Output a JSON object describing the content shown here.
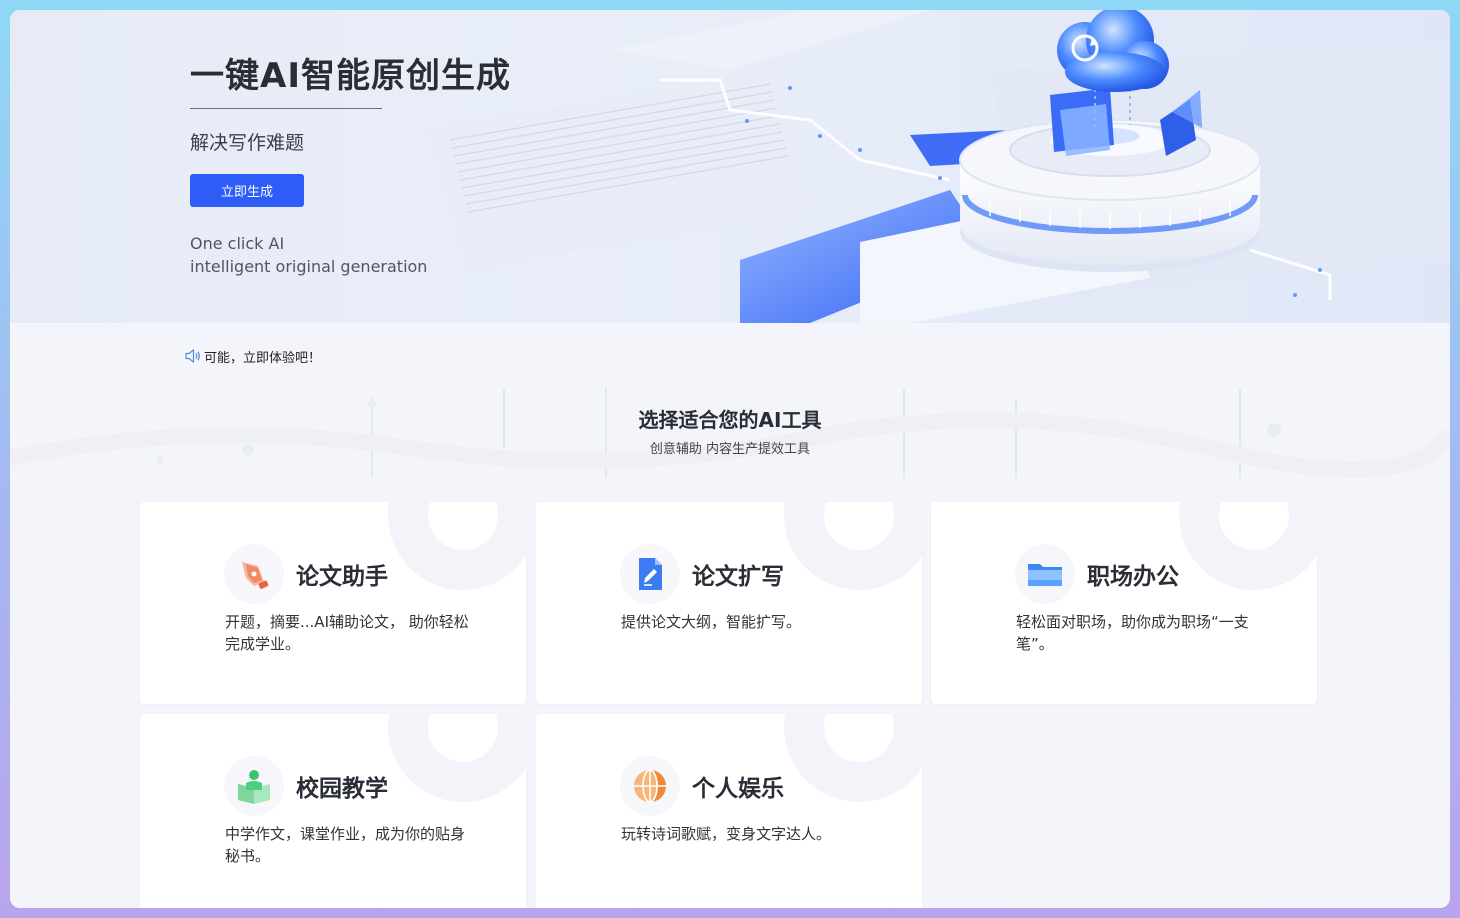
{
  "hero": {
    "title": "一键AI智能原创生成",
    "subtitle": "解决写作难题",
    "button_label": "立即生成",
    "english_line1": "One click AI",
    "english_line2": "intelligent original generation"
  },
  "notice": {
    "text": "可能，立即体验吧！",
    "icon": "speaker-icon"
  },
  "section": {
    "title": "选择适合您的AI工具",
    "subtitle": "创意辅助 内容生产提效工具"
  },
  "cards": [
    {
      "name": "论文助手",
      "desc": "开题，摘要...AI辅助论文， 助你轻松完成学业。",
      "icon": "pen-nib-icon"
    },
    {
      "name": "论文扩写",
      "desc": "提供论文大纲，智能扩写。",
      "icon": "document-edit-icon"
    },
    {
      "name": "职场办公",
      "desc": "轻松面对职场，助你成为职场“一支笔”。",
      "icon": "folder-icon"
    },
    {
      "name": "校园教学",
      "desc": "中学作文，课堂作业，成为你的贴身秘书。",
      "icon": "book-reader-icon"
    },
    {
      "name": "个人娱乐",
      "desc": "玩转诗词歌赋，变身文字达人。",
      "icon": "globe-icon"
    }
  ],
  "colors": {
    "accent": "#2e5cf6",
    "hero_bg": "#e6ebf5",
    "page_bg": "#f3f5fa"
  }
}
